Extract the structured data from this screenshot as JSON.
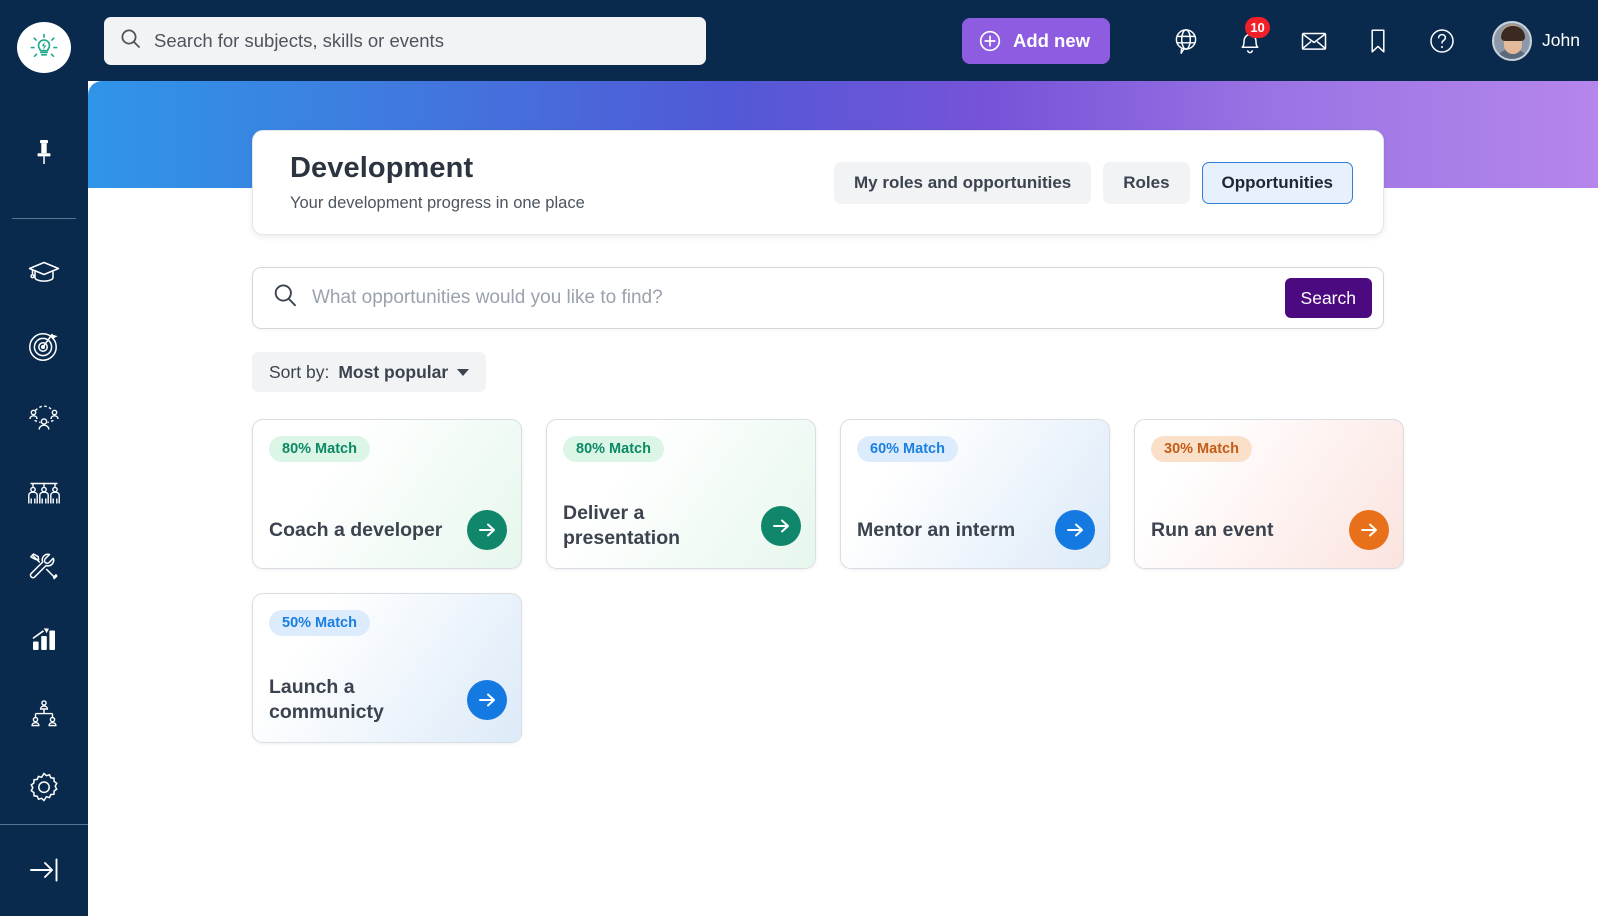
{
  "sidebar": {
    "logo_icon": "lightbulb-idea-icon",
    "items": [
      {
        "icon": "pin-icon",
        "name": "pin"
      },
      {
        "icon": "graduation-cap-icon",
        "name": "learning"
      },
      {
        "icon": "target-goal-icon",
        "name": "goals"
      },
      {
        "icon": "team-network-icon",
        "name": "team"
      },
      {
        "icon": "people-group-icon",
        "name": "people"
      },
      {
        "icon": "tools-icon",
        "name": "tools"
      },
      {
        "icon": "bar-chart-icon",
        "name": "analytics"
      },
      {
        "icon": "org-chart-icon",
        "name": "org-chart"
      },
      {
        "icon": "gear-icon",
        "name": "settings"
      }
    ],
    "collapse_icon": "arrow-to-line-right-icon"
  },
  "topbar": {
    "search_placeholder": "Search for subjects, skills or events",
    "search_value": "",
    "search_icon": "search-icon",
    "add_new_label": "Add new",
    "add_new_icon": "plus-circle-icon",
    "icons": [
      {
        "name": "globe-chat-icon",
        "badge": ""
      },
      {
        "name": "bell-icon",
        "badge": "10"
      },
      {
        "name": "envelope-icon",
        "badge": ""
      },
      {
        "name": "bookmark-icon",
        "badge": ""
      },
      {
        "name": "help-circle-icon",
        "badge": ""
      }
    ],
    "notification_count": "10",
    "user_name": "John"
  },
  "header": {
    "title": "Development",
    "subtitle": "Your development progress in one place",
    "tabs": [
      {
        "label": "My roles and opportunities",
        "active": false
      },
      {
        "label": "Roles",
        "active": false
      },
      {
        "label": "Opportunities",
        "active": true
      }
    ]
  },
  "opportunity_search": {
    "placeholder": "What opportunities would you like to find?",
    "value": "",
    "icon": "search-icon",
    "button_label": "Search"
  },
  "sort": {
    "prefix": "Sort by:",
    "value": "Most popular",
    "icon": "chevron-down-icon"
  },
  "cards": [
    {
      "match": "80% Match",
      "title": "Coach a developer",
      "theme": "green"
    },
    {
      "match": "80% Match",
      "title": "Deliver a presentation",
      "theme": "green"
    },
    {
      "match": "60% Match",
      "title": "Mentor an interm",
      "theme": "blue"
    },
    {
      "match": "30% Match",
      "title": "Run an event",
      "theme": "orange"
    },
    {
      "match": "50% Match",
      "title": "Launch a communicty",
      "theme": "blue"
    }
  ],
  "colors": {
    "sidebar_bg": "#0a2a4d",
    "topbar_bg": "#0a2a4d",
    "add_new": "#8d5ce0",
    "search_button": "#4c0a80",
    "badge_red": "#f01f28",
    "banner_from": "#2f95e8",
    "banner_to": "#b586ec",
    "green_accent": "#10866a",
    "blue_accent": "#1479e0",
    "orange_accent": "#e8701a"
  }
}
